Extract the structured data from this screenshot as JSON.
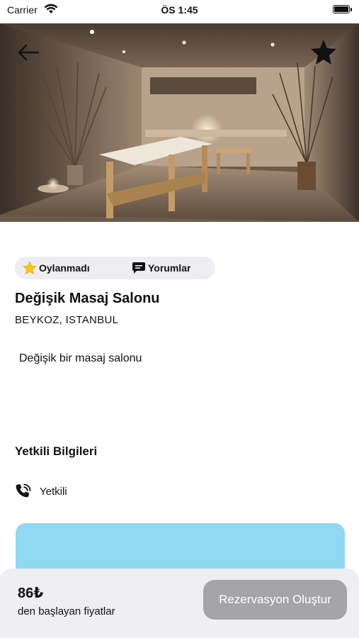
{
  "status_bar": {
    "carrier": "Carrier",
    "time": "ÖS 1:45"
  },
  "hero": {
    "image": "spa-massage-room-photo"
  },
  "header": {
    "back_icon": "arrow-left-icon",
    "favorite_icon": "star-filled-icon"
  },
  "stats": {
    "rating_label": "Oylanmadı",
    "rating_icon": "star-icon",
    "reviews_label": "Yorumlar",
    "reviews_icon": "chat-bubble-icon",
    "star_color": "#f5c518"
  },
  "venue": {
    "name": "Değişik Masaj Salonu",
    "location": "BEYKOZ, ISTANBUL",
    "description": "Değişik bir masaj salonu"
  },
  "contact": {
    "section_title": "Yetkili Bilgileri",
    "icon": "phone-ringing-icon",
    "label": "Yetkili"
  },
  "map": {
    "color": "#8fd9f2"
  },
  "footer": {
    "price": "86₺",
    "price_caption": "den başlayan fiyatlar",
    "reserve_label": "Rezervasyon Oluştur",
    "button_color": "#a5a5a9"
  }
}
